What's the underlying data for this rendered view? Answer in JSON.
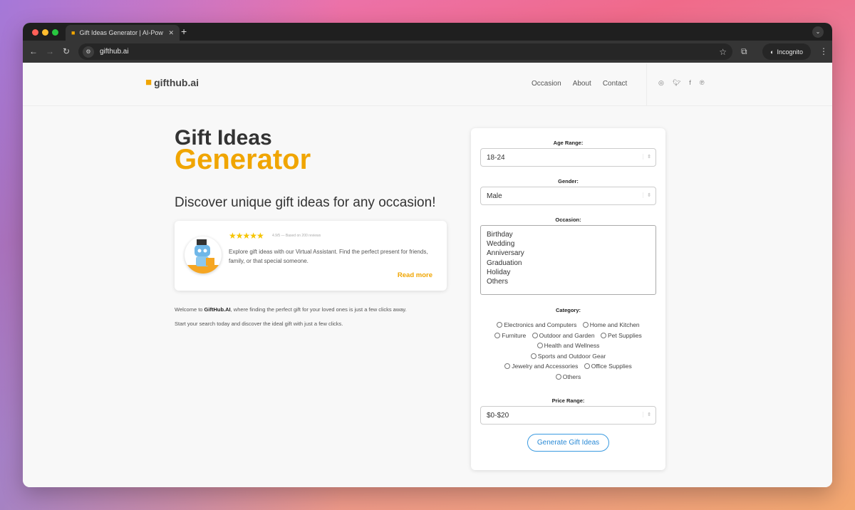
{
  "browser": {
    "tab_title": "Gift Ideas Generator | AI-Pow",
    "url": "gifthub.ai",
    "incognito_label": "Incognito"
  },
  "site": {
    "logo": "gifthub.ai",
    "nav": [
      "Occasion",
      "About",
      "Contact"
    ],
    "social_icons": [
      "instagram-icon",
      "twitter-icon",
      "facebook-icon",
      "pinterest-icon"
    ]
  },
  "hero": {
    "title_line1": "Gift Ideas",
    "title_line2": "Generator",
    "subtitle": "Discover unique gift ideas for any occasion!",
    "accent_color": "#f0a500"
  },
  "card": {
    "stars": "★★★★★",
    "rating": "4.9/5 — Based on 200 reviews",
    "text": "Explore gift ideas with our Virtual Assistant. Find the perfect present for friends, family, or that special someone.",
    "read_more": "Read more"
  },
  "intro": {
    "brand": "GiftHub.AI",
    "p1_before": "Welcome to ",
    "p1_after": ", where finding the perfect gift for your loved ones is just a few clicks away.",
    "p2": "Start your search today and discover the ideal gift with just a few clicks."
  },
  "form": {
    "age_label": "Age Range:",
    "age_value": "18-24",
    "gender_label": "Gender:",
    "gender_value": "Male",
    "occasion_label": "Occasion:",
    "occasions": [
      "Birthday",
      "Wedding",
      "Anniversary",
      "Graduation",
      "Holiday",
      "Others"
    ],
    "category_label": "Category:",
    "categories": [
      "Electronics and Computers",
      "Home and Kitchen",
      "Furniture",
      "Outdoor and Garden",
      "Pet Supplies",
      "Health and Wellness",
      "Sports and Outdoor Gear",
      "Jewelry and Accessories",
      "Office Supplies",
      "Others"
    ],
    "price_label": "Price Range:",
    "price_value": "$0-$20",
    "submit": "Generate Gift Ideas"
  }
}
